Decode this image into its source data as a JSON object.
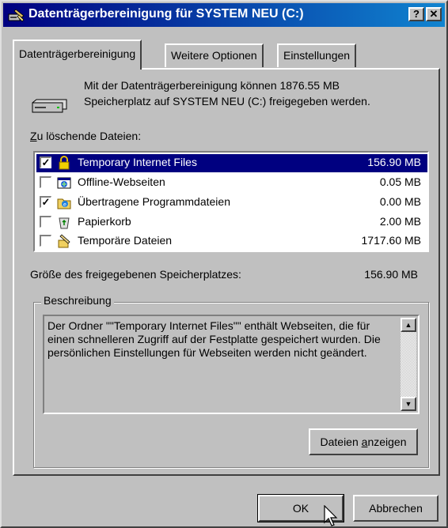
{
  "window": {
    "title": "Datenträgerbereinigung für SYSTEM NEU (C:)",
    "help_button": "?",
    "close_button": "✕"
  },
  "tabs": [
    {
      "label": "Datenträgerbereinigung",
      "active": true
    },
    {
      "label": "Weitere Optionen",
      "active": false
    },
    {
      "label": "Einstellungen",
      "active": false
    }
  ],
  "intro": {
    "line1": "Mit der Datenträgerbereinigung können 1876.55 MB",
    "line2": "Speicherplatz auf SYSTEM NEU (C:) freigegeben werden."
  },
  "files_label_prefix": "Z",
  "files_label_rest": "u löschende Dateien:",
  "files": [
    {
      "label": "Temporary Internet Files",
      "size": "156.90 MB",
      "checked": true,
      "selected": true,
      "icon": "lock-folder-icon"
    },
    {
      "label": "Offline-Webseiten",
      "size": "0.05 MB",
      "checked": false,
      "selected": false,
      "icon": "offline-pages-icon"
    },
    {
      "label": "Übertragene Programmdateien",
      "size": "0.00 MB",
      "checked": true,
      "selected": false,
      "icon": "downloaded-programs-icon"
    },
    {
      "label": "Papierkorb",
      "size": "2.00 MB",
      "checked": false,
      "selected": false,
      "icon": "recycle-bin-icon"
    },
    {
      "label": "Temporäre Dateien",
      "size": "1717.60 MB",
      "checked": false,
      "selected": false,
      "icon": "temp-files-icon"
    }
  ],
  "freed": {
    "label": "Größe des freigegebenen Speicherplatzes:",
    "value": "156.90 MB"
  },
  "description": {
    "group_label": "Beschreibung",
    "text": "Der Ordner \"\"Temporary Internet Files\"\" enthält Webseiten, die für einen schnelleren Zugriff auf der Festplatte gespeichert wurden. Die persönlichen Einstellungen für Webseiten werden nicht geändert."
  },
  "buttons": {
    "show_files_prefix": "Dateien ",
    "show_files_access": "a",
    "show_files_rest": "nzeigen",
    "ok": "OK",
    "cancel": "Abbrechen"
  },
  "colors": {
    "titlebar_start": "#000080",
    "titlebar_end": "#1084d0",
    "selection": "#000080",
    "face": "#c0c0c0"
  }
}
